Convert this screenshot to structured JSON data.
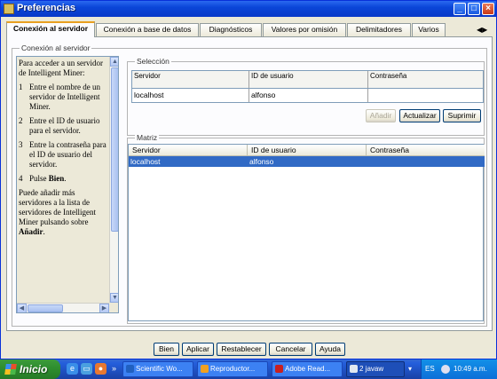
{
  "window": {
    "title": "Preferencias"
  },
  "tabs": [
    {
      "label": "Conexión al servidor",
      "active": true
    },
    {
      "label": "Conexión a base de datos"
    },
    {
      "label": "Diagnósticos"
    },
    {
      "label": "Valores por omisión"
    },
    {
      "label": "Delimitadores"
    },
    {
      "label": "Varios"
    }
  ],
  "panel": {
    "group_label": "Conexión al servidor",
    "help": {
      "intro": "Para acceder a un servidor de Intelligent Miner:",
      "steps": [
        {
          "num": "1",
          "text": "Entre el nombre de un servidor de Intelligent Miner."
        },
        {
          "num": "2",
          "text": "Entre el ID de usuario para el servidor."
        },
        {
          "num": "3",
          "text": "Entre la contraseña para el ID de usuario del servidor."
        },
        {
          "num": "4",
          "text": "Pulse ",
          "bold": "Bien",
          "after": "."
        }
      ],
      "outro": "Puede añadir más servidores a la lista de servidores de Intelligent Miner pulsando sobre ",
      "outro_bold": "Añadir",
      "outro_after": "."
    },
    "seleccion": {
      "label": "Selección",
      "columns": [
        "Servidor",
        "ID de usuario",
        "Contraseña"
      ],
      "values": {
        "servidor": "localhost",
        "usuario": "alfonso",
        "contrasena": ""
      },
      "buttons": {
        "add": "Añadir",
        "update": "Actualizar",
        "delete": "Suprimir"
      }
    },
    "matriz": {
      "label": "Matriz",
      "columns": [
        "Servidor",
        "ID de usuario",
        "Contraseña"
      ],
      "rows": [
        {
          "servidor": "localhost",
          "usuario": "alfonso",
          "contrasena": ""
        }
      ]
    }
  },
  "dialog_buttons": {
    "ok": "Bien",
    "apply": "Aplicar",
    "reset": "Restablecer",
    "cancel": "Cancelar",
    "help": "Ayuda"
  },
  "taskbar": {
    "start": "Inicio",
    "tasks": [
      {
        "label": "Scientific Wo...",
        "icon": "scientific-workplace-icon"
      },
      {
        "label": "Reproductor...",
        "icon": "media-player-icon"
      },
      {
        "label": "Adobe Read...",
        "icon": "adobe-reader-icon"
      },
      {
        "label": "2 javaw",
        "icon": "java-icon"
      }
    ],
    "language": "ES",
    "clock": "10:49 a.m."
  },
  "colors": {
    "title_bar": "#0a46d8",
    "selection": "#316ac5",
    "window_bg": "#ece9d8",
    "taskbar": "#245edb",
    "start_button": "#2f8f2f"
  }
}
